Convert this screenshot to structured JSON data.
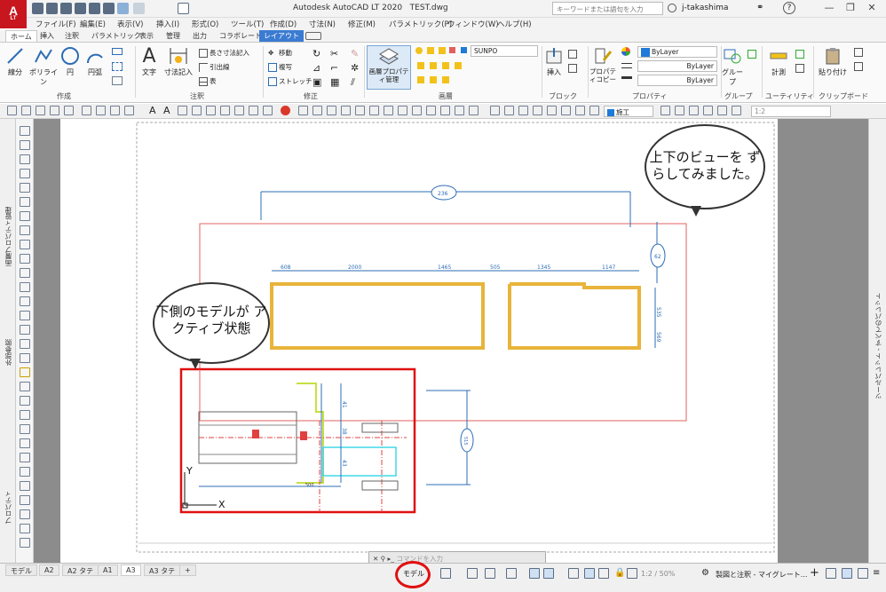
{
  "app": {
    "logo": "A",
    "logo_sub": "LT",
    "title": "Autodesk AutoCAD LT 2020",
    "filename": "TEST.dwg",
    "search_placeholder": "キーワードまたは語句を入力",
    "user": "j-takashima"
  },
  "menu": [
    "ファイル(F)",
    "編集(E)",
    "表示(V)",
    "挿入(I)",
    "形式(O)",
    "ツール(T)",
    "作成(D)",
    "寸法(N)",
    "修正(M)",
    "パラメトリック(P)",
    "ウィンドウ(W)",
    "ヘルプ(H)"
  ],
  "tabs": [
    "ホーム",
    "挿入",
    "注釈",
    "パラメトリック",
    "表示",
    "管理",
    "出力",
    "コラボレート",
    "レイアウト"
  ],
  "ribbon": {
    "draw": {
      "title": "作成",
      "line": "線分",
      "polyline": "ポリライン",
      "circle": "円",
      "arc": "円弧"
    },
    "annotation": {
      "title": "注釈",
      "text": "文字",
      "dim": "寸法記入",
      "linear": "長さ寸法記入",
      "leader": "引出線",
      "table": "表"
    },
    "modify": {
      "title": "修正",
      "move": "移動",
      "copy": "複写",
      "stretch": "ストレッチ"
    },
    "layers": {
      "title": "画層",
      "props": "画層プロパティ管理",
      "current": "SUNPO"
    },
    "block": {
      "title": "ブロック",
      "insert": "挿入"
    },
    "properties": {
      "title": "プロパティ",
      "match": "プロパティコピー",
      "color": "ByLayer",
      "linetype": "ByLayer",
      "lineweight": "ByLayer"
    },
    "groups": {
      "title": "グループ",
      "group": "グループ"
    },
    "utilities": {
      "title": "ユーティリティ",
      "measure": "計測"
    },
    "clipboard": {
      "title": "クリップボード",
      "paste": "貼り付け"
    }
  },
  "toolbar": {
    "dimstyle": "施工",
    "scale": "1:2"
  },
  "palettes": {
    "left_top": "画層プロパティ管理",
    "left_mid": "外部参照",
    "left_bottom": "プロパティ",
    "right": "ツールパレット - すべてのパレット"
  },
  "drawing": {
    "dims_top": [
      "608",
      "2000",
      "1465",
      "505",
      "1345",
      "1147"
    ],
    "dim_overall": "236",
    "dim_right": [
      "535",
      "569"
    ],
    "dim_side": "62",
    "dim_vp": [
      "41",
      "38",
      "43",
      "500",
      "515"
    ],
    "ucs_y": "Y",
    "ucs_x": "X"
  },
  "bubbles": {
    "top": "上下のビューを ずらしてみました。",
    "left": "下側のモデルが アクティブ状態"
  },
  "layout_tabs": [
    "モデル",
    "A2",
    "A2 タテ",
    "A1",
    "A3",
    "A3 タテ",
    "+"
  ],
  "layout_active": "A3",
  "status": {
    "model": "モデル",
    "scale": "1:2 / 50%",
    "annotation": "製図と注釈 - マイグレート...",
    "command_placeholder": "コマンドを入力"
  }
}
